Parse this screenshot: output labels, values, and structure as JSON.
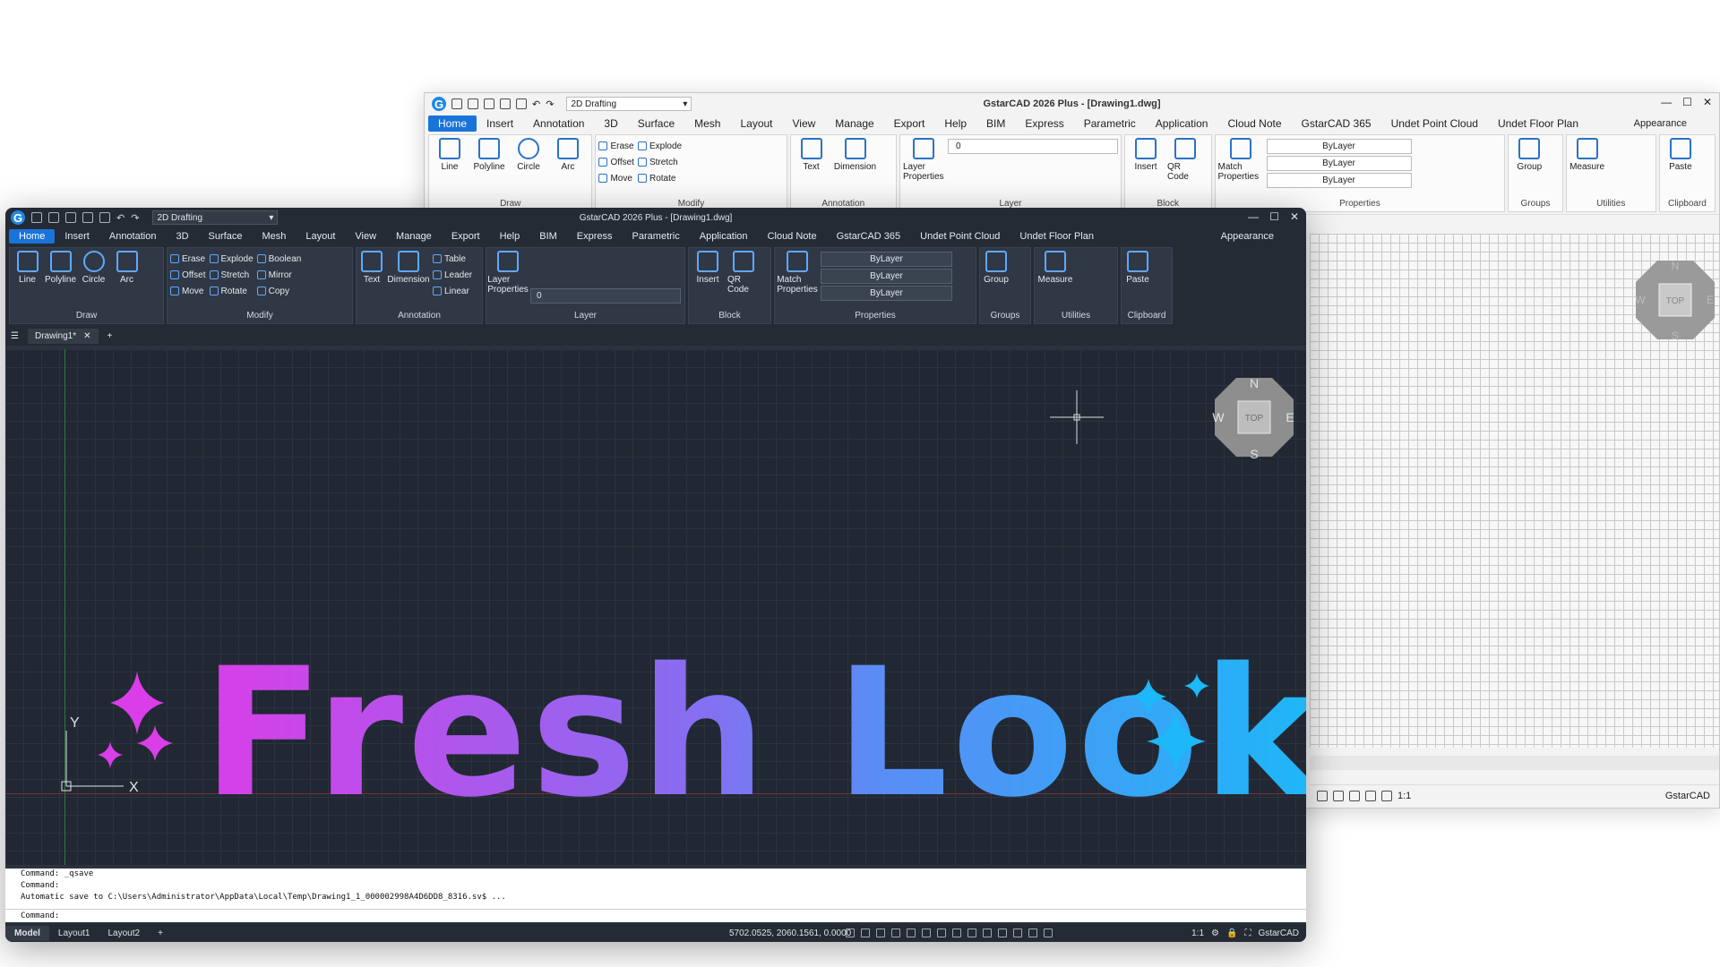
{
  "app_title": "GstarCAD 2026 Plus - [Drawing1.dwg]",
  "workspace": "2D Drafting",
  "appearance": "Appearance",
  "tabs": [
    "Home",
    "Insert",
    "Annotation",
    "3D",
    "Surface",
    "Mesh",
    "Layout",
    "View",
    "Manage",
    "Export",
    "Help",
    "BIM",
    "Express",
    "Parametric",
    "Application",
    "Cloud Note",
    "GstarCAD 365",
    "Undet Point Cloud",
    "Undet Floor Plan"
  ],
  "ribbon": {
    "draw": {
      "title": "Draw",
      "buttons": [
        "Line",
        "Polyline",
        "Circle",
        "Arc"
      ]
    },
    "modify": {
      "title": "Modify",
      "items": [
        "Erase",
        "Explode",
        "Boolean",
        "Offset",
        "Stretch",
        "Mirror",
        "Move",
        "Rotate",
        "Copy"
      ]
    },
    "annotation": {
      "title": "Annotation",
      "buttons": [
        "Text",
        "Dimension"
      ],
      "items": [
        "Table",
        "Leader",
        "Linear"
      ]
    },
    "layer": {
      "title": "Layer",
      "button": "Layer Properties",
      "current": "0"
    },
    "block": {
      "title": "Block",
      "buttons": [
        "Insert",
        "QR Code"
      ]
    },
    "properties": {
      "title": "Properties",
      "button": "Match Properties",
      "dropdowns": [
        "ByLayer",
        "ByLayer",
        "ByLayer"
      ]
    },
    "groups": {
      "title": "Groups",
      "button": "Group"
    },
    "utilities": {
      "title": "Utilities",
      "button": "Measure"
    },
    "clipboard": {
      "title": "Clipboard",
      "button": "Paste"
    }
  },
  "back_ribbon": {
    "modify_items": [
      "Erase",
      "Explode",
      "Offset",
      "Stretch",
      "Move",
      "Rotate"
    ]
  },
  "doc_tab": "Drawing1*",
  "headline": "Fresh Look",
  "viewcube": {
    "top": "TOP",
    "n": "N",
    "s": "S",
    "e": "E",
    "w": "W"
  },
  "ucs": {
    "x": "X",
    "y": "Y"
  },
  "command_history": [
    "Command: _qsave",
    "Command:",
    "Automatic save to C:\\Users\\Administrator\\AppData\\Local\\Temp\\Drawing1_1_000002998A4D6DD8_8316.sv$ ..."
  ],
  "command_prompt": "Command:",
  "layouts": [
    "Model",
    "Layout1",
    "Layout2"
  ],
  "coordinates": "5702.0525, 2060.1561, 0.0000",
  "scale": "1:1",
  "brand": "GstarCAD",
  "colors": {
    "accent": "#1a73d9",
    "dark_bg": "#212833",
    "headline_start": "#d93ee8",
    "headline_end": "#1cb8f7"
  }
}
